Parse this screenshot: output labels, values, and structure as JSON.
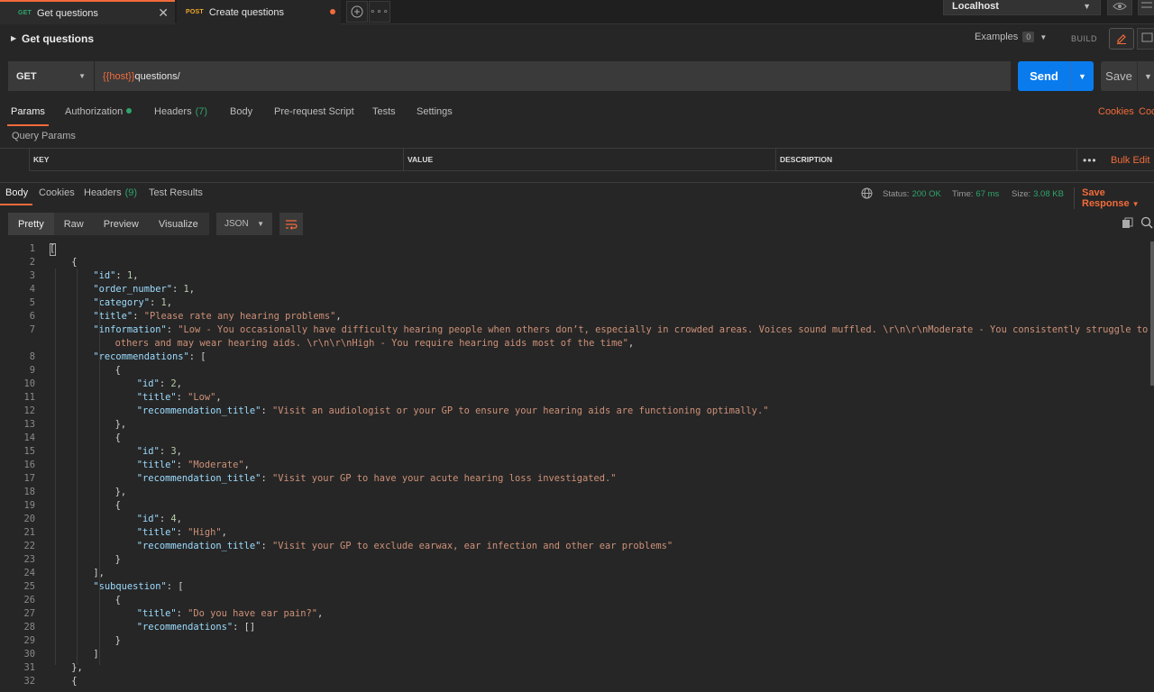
{
  "tabs": [
    {
      "method": "GET",
      "title": "Get questions"
    },
    {
      "method": "POST",
      "title": "Create questions"
    }
  ],
  "environment": "Localhost",
  "request": {
    "name": "Get questions",
    "examples_label": "Examples",
    "examples_count": "0",
    "build_label": "BUILD",
    "method": "GET",
    "url_var": "{{host}}",
    "url_path": "questions/",
    "send_label": "Send",
    "save_label": "Save"
  },
  "request_tabs": {
    "params": "Params",
    "authorization": "Authorization",
    "headers": "Headers",
    "headers_count": "(7)",
    "body": "Body",
    "prerequest": "Pre-request Script",
    "tests": "Tests",
    "settings": "Settings",
    "cookies": "Cookies",
    "code": "Coc"
  },
  "query_params": {
    "label": "Query Params",
    "columns": [
      "KEY",
      "VALUE",
      "DESCRIPTION"
    ],
    "bulk_edit": "Bulk Edit"
  },
  "response": {
    "tabs": {
      "body": "Body",
      "cookies": "Cookies",
      "headers": "Headers",
      "headers_count": "(9)",
      "tests": "Test Results"
    },
    "status_label": "Status:",
    "status_value": "200 OK",
    "time_label": "Time:",
    "time_value": "67 ms",
    "size_label": "Size:",
    "size_value": "3.08 KB",
    "save_response": "Save Response",
    "views": [
      "Pretty",
      "Raw",
      "Preview",
      "Visualize"
    ],
    "format": "JSON"
  },
  "code_lines": [
    {
      "n": "1",
      "indent": 0,
      "parts": [
        [
          "p",
          "["
        ]
      ]
    },
    {
      "n": "2",
      "indent": 1,
      "parts": [
        [
          "p",
          "{"
        ]
      ]
    },
    {
      "n": "3",
      "indent": 2,
      "parts": [
        [
          "k",
          "\"id\""
        ],
        [
          "p",
          ": "
        ],
        [
          "n",
          "1"
        ],
        [
          "p",
          ","
        ]
      ]
    },
    {
      "n": "4",
      "indent": 2,
      "parts": [
        [
          "k",
          "\"order_number\""
        ],
        [
          "p",
          ": "
        ],
        [
          "n",
          "1"
        ],
        [
          "p",
          ","
        ]
      ]
    },
    {
      "n": "5",
      "indent": 2,
      "parts": [
        [
          "k",
          "\"category\""
        ],
        [
          "p",
          ": "
        ],
        [
          "n",
          "1"
        ],
        [
          "p",
          ","
        ]
      ]
    },
    {
      "n": "6",
      "indent": 2,
      "parts": [
        [
          "k",
          "\"title\""
        ],
        [
          "p",
          ": "
        ],
        [
          "s",
          "\"Please rate any hearing problems\""
        ],
        [
          "p",
          ","
        ]
      ]
    },
    {
      "n": "7",
      "indent": 2,
      "parts": [
        [
          "k",
          "\"information\""
        ],
        [
          "p",
          ": "
        ],
        [
          "s",
          "\"Low - You occasionally have difficulty hearing people when others don’t, especially in crowded areas. Voices sound muffled. \\r\\n\\r\\nModerate - You consistently struggle to hear"
        ]
      ]
    },
    {
      "n": "",
      "indent": 3,
      "parts": [
        [
          "s",
          "others and may wear hearing aids. \\r\\n\\r\\nHigh - You require hearing aids most of the time\""
        ],
        [
          "p",
          ","
        ]
      ]
    },
    {
      "n": "8",
      "indent": 2,
      "parts": [
        [
          "k",
          "\"recommendations\""
        ],
        [
          "p",
          ": ["
        ]
      ]
    },
    {
      "n": "9",
      "indent": 3,
      "parts": [
        [
          "p",
          "{"
        ]
      ]
    },
    {
      "n": "10",
      "indent": 4,
      "parts": [
        [
          "k",
          "\"id\""
        ],
        [
          "p",
          ": "
        ],
        [
          "n",
          "2"
        ],
        [
          "p",
          ","
        ]
      ]
    },
    {
      "n": "11",
      "indent": 4,
      "parts": [
        [
          "k",
          "\"title\""
        ],
        [
          "p",
          ": "
        ],
        [
          "s",
          "\"Low\""
        ],
        [
          "p",
          ","
        ]
      ]
    },
    {
      "n": "12",
      "indent": 4,
      "parts": [
        [
          "k",
          "\"recommendation_title\""
        ],
        [
          "p",
          ": "
        ],
        [
          "s",
          "\"Visit an audiologist or your GP to ensure your hearing aids are functioning optimally.\""
        ]
      ]
    },
    {
      "n": "13",
      "indent": 3,
      "parts": [
        [
          "p",
          "},"
        ]
      ]
    },
    {
      "n": "14",
      "indent": 3,
      "parts": [
        [
          "p",
          "{"
        ]
      ]
    },
    {
      "n": "15",
      "indent": 4,
      "parts": [
        [
          "k",
          "\"id\""
        ],
        [
          "p",
          ": "
        ],
        [
          "n",
          "3"
        ],
        [
          "p",
          ","
        ]
      ]
    },
    {
      "n": "16",
      "indent": 4,
      "parts": [
        [
          "k",
          "\"title\""
        ],
        [
          "p",
          ": "
        ],
        [
          "s",
          "\"Moderate\""
        ],
        [
          "p",
          ","
        ]
      ]
    },
    {
      "n": "17",
      "indent": 4,
      "parts": [
        [
          "k",
          "\"recommendation_title\""
        ],
        [
          "p",
          ": "
        ],
        [
          "s",
          "\"Visit your GP to have your acute hearing loss investigated.\""
        ]
      ]
    },
    {
      "n": "18",
      "indent": 3,
      "parts": [
        [
          "p",
          "},"
        ]
      ]
    },
    {
      "n": "19",
      "indent": 3,
      "parts": [
        [
          "p",
          "{"
        ]
      ]
    },
    {
      "n": "20",
      "indent": 4,
      "parts": [
        [
          "k",
          "\"id\""
        ],
        [
          "p",
          ": "
        ],
        [
          "n",
          "4"
        ],
        [
          "p",
          ","
        ]
      ]
    },
    {
      "n": "21",
      "indent": 4,
      "parts": [
        [
          "k",
          "\"title\""
        ],
        [
          "p",
          ": "
        ],
        [
          "s",
          "\"High\""
        ],
        [
          "p",
          ","
        ]
      ]
    },
    {
      "n": "22",
      "indent": 4,
      "parts": [
        [
          "k",
          "\"recommendation_title\""
        ],
        [
          "p",
          ": "
        ],
        [
          "s",
          "\"Visit your GP to exclude earwax, ear infection and other ear problems\""
        ]
      ]
    },
    {
      "n": "23",
      "indent": 3,
      "parts": [
        [
          "p",
          "}"
        ]
      ]
    },
    {
      "n": "24",
      "indent": 2,
      "parts": [
        [
          "p",
          "],"
        ]
      ]
    },
    {
      "n": "25",
      "indent": 2,
      "parts": [
        [
          "k",
          "\"subquestion\""
        ],
        [
          "p",
          ": ["
        ]
      ]
    },
    {
      "n": "26",
      "indent": 3,
      "parts": [
        [
          "p",
          "{"
        ]
      ]
    },
    {
      "n": "27",
      "indent": 4,
      "parts": [
        [
          "k",
          "\"title\""
        ],
        [
          "p",
          ": "
        ],
        [
          "s",
          "\"Do you have ear pain?\""
        ],
        [
          "p",
          ","
        ]
      ]
    },
    {
      "n": "28",
      "indent": 4,
      "parts": [
        [
          "k",
          "\"recommendations\""
        ],
        [
          "p",
          ": []"
        ]
      ]
    },
    {
      "n": "29",
      "indent": 3,
      "parts": [
        [
          "p",
          "}"
        ]
      ]
    },
    {
      "n": "30",
      "indent": 2,
      "parts": [
        [
          "p",
          "]"
        ]
      ]
    },
    {
      "n": "31",
      "indent": 1,
      "parts": [
        [
          "p",
          "},"
        ]
      ]
    },
    {
      "n": "32",
      "indent": 1,
      "parts": [
        [
          "p",
          "{"
        ]
      ]
    }
  ]
}
